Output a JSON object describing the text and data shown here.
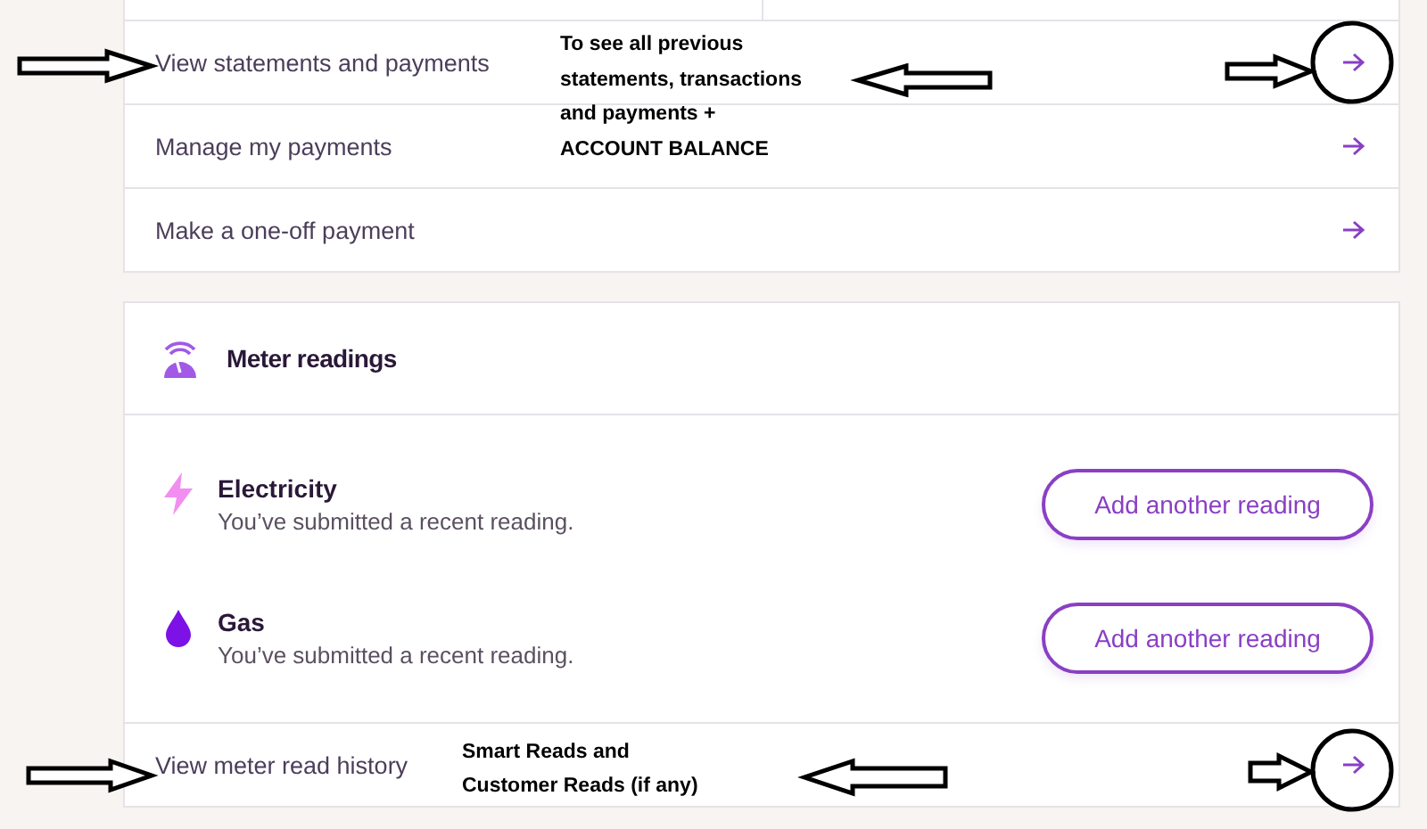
{
  "payments_card": {
    "links": [
      {
        "label": "View statements and payments"
      },
      {
        "label": "Manage my payments"
      },
      {
        "label": "Make a one-off payment"
      }
    ]
  },
  "meter_card": {
    "title": "Meter readings",
    "meters": [
      {
        "kind": "electricity",
        "name": "Electricity",
        "status": "You’ve submitted a recent reading.",
        "button": "Add another reading"
      },
      {
        "kind": "gas",
        "name": "Gas",
        "status": "You’ve submitted a recent reading.",
        "button": "Add another reading"
      }
    ],
    "history_link": "View meter read history"
  },
  "annotations": [
    {
      "lines": [
        "To see all previous",
        "statements, transactions",
        "and payments +",
        "ACCOUNT BALANCE"
      ]
    },
    {
      "lines": [
        "Smart Reads and",
        "Customer Reads (if any)"
      ]
    }
  ]
}
